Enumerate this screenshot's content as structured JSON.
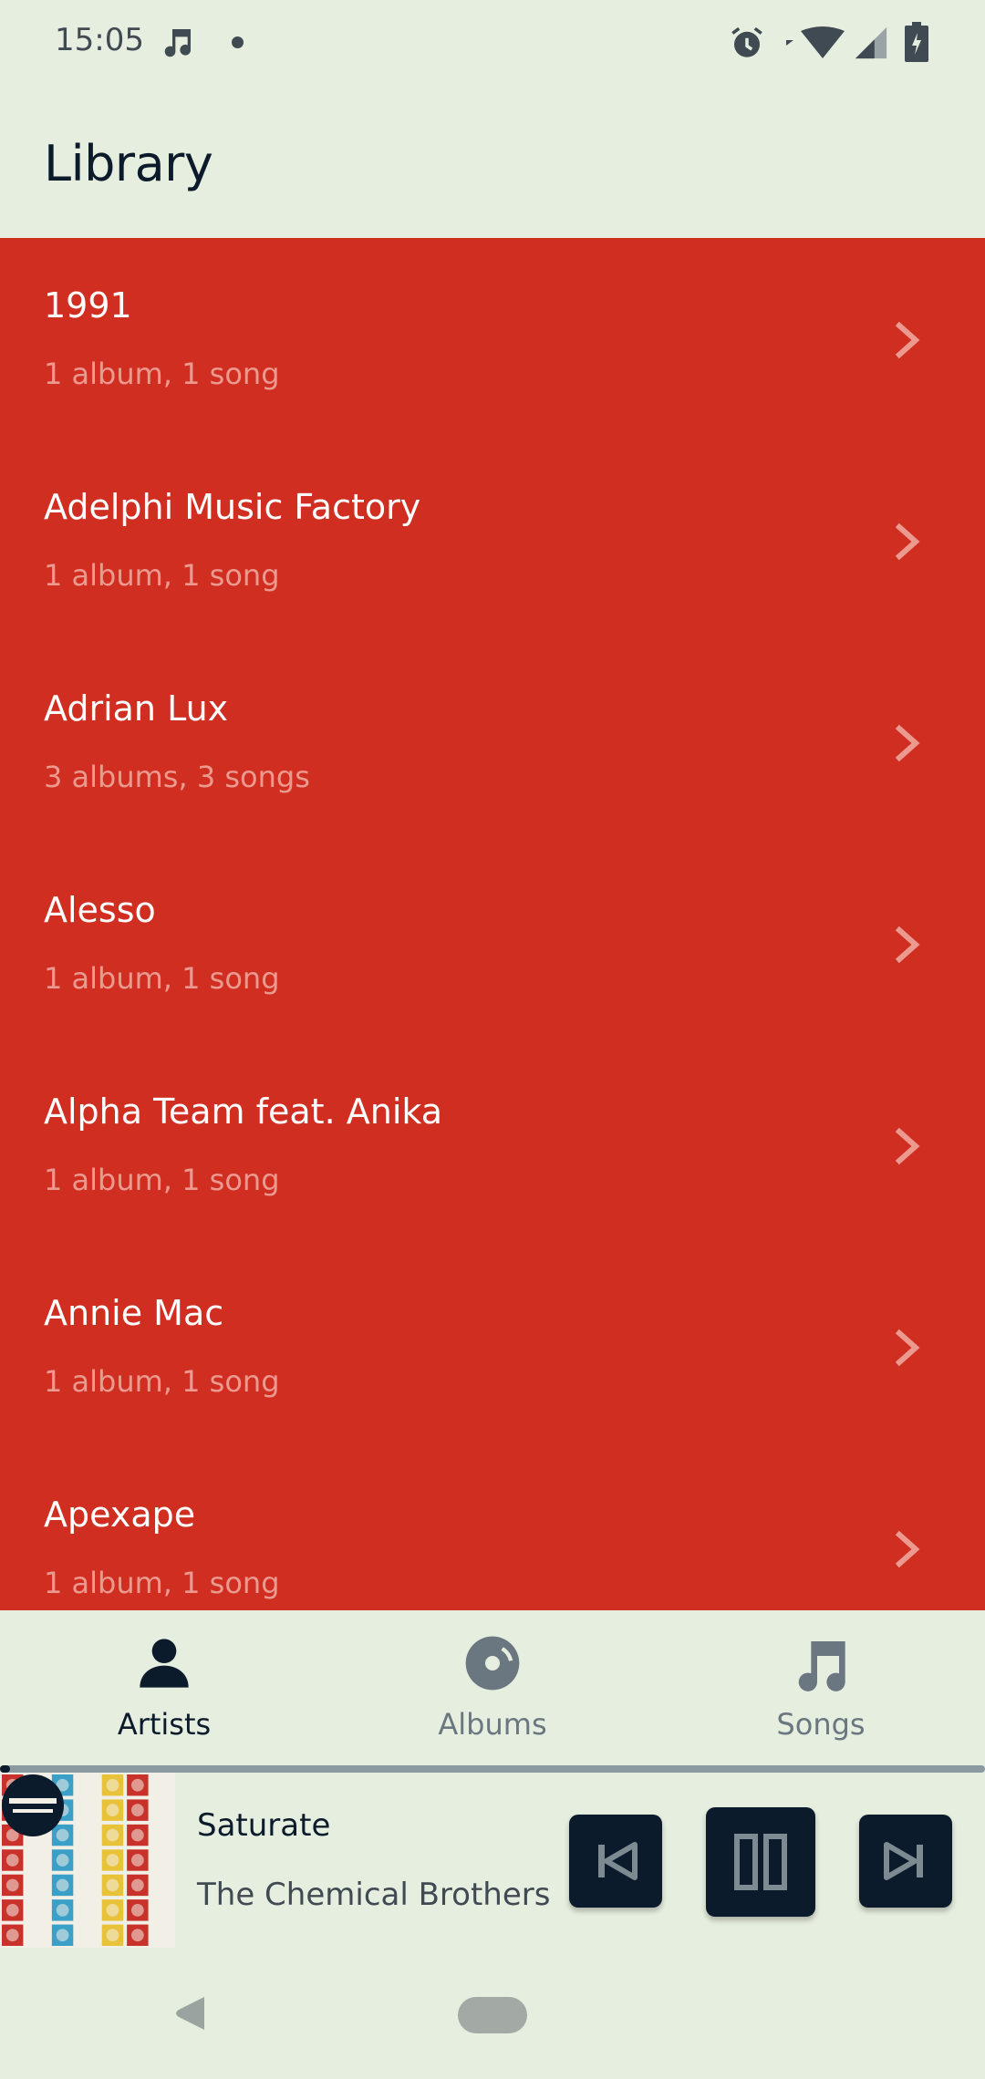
{
  "status_bar": {
    "time": "15:05",
    "icons": [
      "music-note-icon",
      "dot-icon",
      "alarm-icon",
      "wifi-icon",
      "signal-icon",
      "battery-icon"
    ]
  },
  "header": {
    "title": "Library"
  },
  "artists": [
    {
      "name": "1991",
      "meta": "1 album, 1 song"
    },
    {
      "name": "Adelphi Music Factory",
      "meta": "1 album, 1 song"
    },
    {
      "name": "Adrian Lux",
      "meta": "3 albums, 3 songs"
    },
    {
      "name": "Alesso",
      "meta": "1 album, 1 song"
    },
    {
      "name": "Alpha Team feat. Anika",
      "meta": "1 album, 1 song"
    },
    {
      "name": "Annie Mac",
      "meta": "1 album, 1 song"
    },
    {
      "name": "Apexape",
      "meta": "1 album, 1 song"
    }
  ],
  "bottom_nav": {
    "items": [
      {
        "label": "Artists",
        "icon": "person-icon",
        "active": true
      },
      {
        "label": "Albums",
        "icon": "disc-icon",
        "active": false
      },
      {
        "label": "Songs",
        "icon": "music-note-icon",
        "active": false
      }
    ]
  },
  "now_playing": {
    "title": "Saturate",
    "artist": "The Chemical Brothers",
    "progress": 0.01
  },
  "colors": {
    "background": "#e6eedf",
    "list_background": "#cf2e20",
    "primary_dark": "#0c1b2c",
    "meta_text": "#ec9a90"
  }
}
